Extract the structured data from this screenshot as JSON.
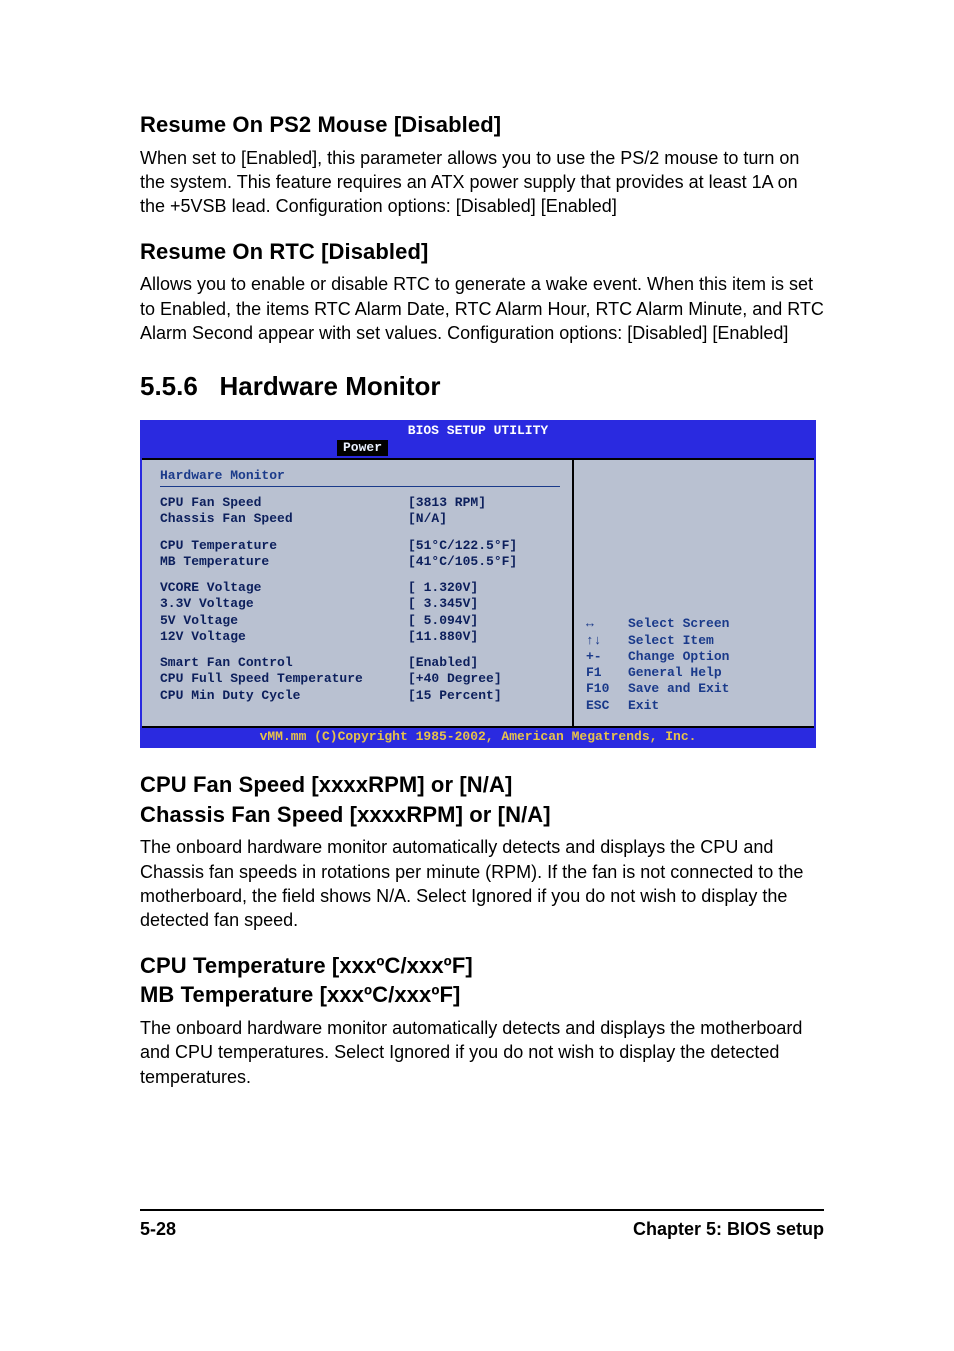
{
  "s1": {
    "title": "Resume On PS2 Mouse [Disabled]",
    "body": "When set to [Enabled], this parameter allows you to use the PS/2 mouse to turn on the system. This feature requires an ATX power supply that provides at least 1A on the +5VSB lead.\nConfiguration options: [Disabled] [Enabled]"
  },
  "s2": {
    "title": "Resume On RTC [Disabled]",
    "body": "Allows you to enable or disable RTC to generate a wake event. When this item is set to Enabled, the items RTC Alarm Date, RTC Alarm Hour, RTC Alarm Minute, and RTC Alarm Second appear with set values. Configuration options: [Disabled] [Enabled]"
  },
  "section": {
    "num": "5.5.6",
    "title": "Hardware Monitor"
  },
  "bios": {
    "title": "BIOS SETUP UTILITY",
    "tab": "Power",
    "panel_title": "Hardware Monitor",
    "rows": [
      {
        "label": "CPU Fan Speed",
        "value": "[3813 RPM]"
      },
      {
        "label": "Chassis Fan Speed",
        "value": "[N/A]"
      }
    ],
    "rows2": [
      {
        "label": "CPU Temperature",
        "value": "[51°C/122.5°F]"
      },
      {
        "label": "MB Temperature",
        "value": "[41°C/105.5°F]"
      }
    ],
    "rows3": [
      {
        "label": "VCORE Voltage",
        "value": "[ 1.320V]"
      },
      {
        "label": "3.3V Voltage",
        "value": "[ 3.345V]"
      },
      {
        "label": "5V Voltage",
        "value": "[ 5.094V]"
      },
      {
        "label": "12V Voltage",
        "value": "[11.880V]"
      }
    ],
    "rows4": [
      {
        "label": "Smart Fan Control",
        "value": "[Enabled]"
      },
      {
        "label": "CPU Full Speed Temperature",
        "value": "[+40 Degree]"
      },
      {
        "label": "CPU Min Duty Cycle",
        "value": "[15 Percent]"
      }
    ],
    "help": [
      {
        "key": "↔",
        "text": "Select Screen"
      },
      {
        "key": "↑↓",
        "text": "Select Item"
      },
      {
        "key": "+-",
        "text": "Change Option"
      },
      {
        "key": "F1",
        "text": "General Help"
      },
      {
        "key": "F10",
        "text": "Save and Exit"
      },
      {
        "key": "ESC",
        "text": "Exit"
      }
    ],
    "footer": "vMM.mm (C)Copyright 1985-2002, American Megatrends, Inc."
  },
  "s3": {
    "title1": "CPU Fan Speed [xxxxRPM] or [N/A]",
    "title2": "Chassis Fan Speed [xxxxRPM] or [N/A]",
    "body": "The onboard hardware monitor automatically detects and displays the CPU and Chassis fan speeds in rotations per minute (RPM). If the fan is not connected to the motherboard, the field shows N/A. Select Ignored if you do not wish to display the detected fan speed."
  },
  "s4": {
    "title1": "CPU Temperature [xxxºC/xxxºF]",
    "title2": "MB Temperature [xxxºC/xxxºF]",
    "body": "The onboard hardware monitor automatically detects and displays the motherboard and CPU temperatures. Select Ignored if you do not wish to display the detected temperatures."
  },
  "footer": {
    "page": "5-28",
    "chapter": "Chapter 5: BIOS setup"
  }
}
